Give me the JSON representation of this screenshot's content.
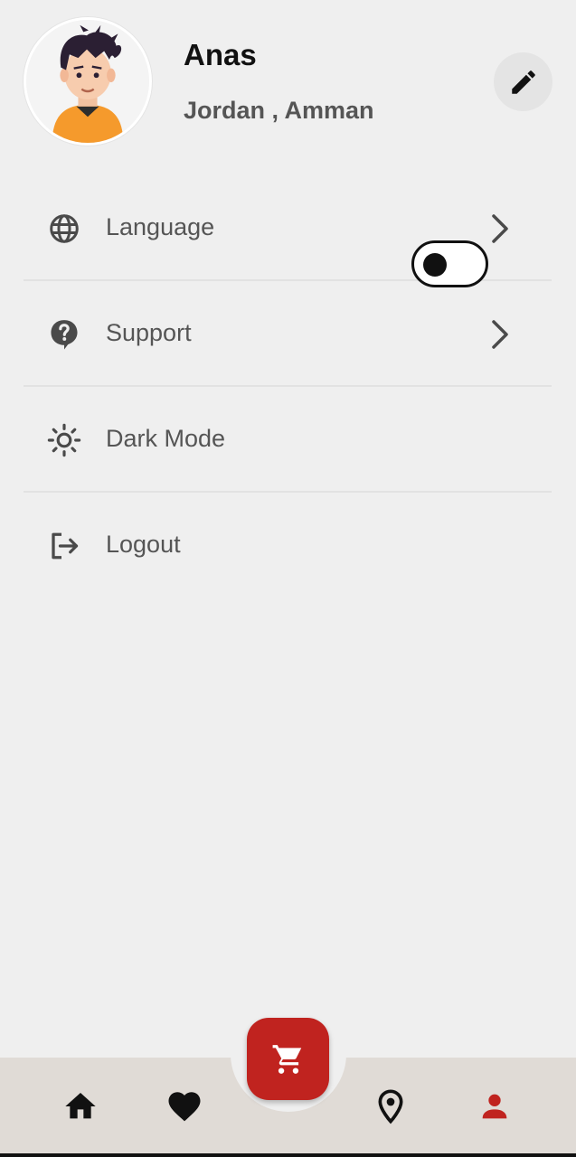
{
  "profile": {
    "name": "Anas",
    "location": "Jordan , Amman"
  },
  "menu": {
    "items": [
      {
        "label": "Language",
        "icon": "globe-icon"
      },
      {
        "label": "Support",
        "icon": "help-circle-icon"
      },
      {
        "label": "Dark Mode",
        "icon": "sun-icon",
        "toggle_on": false
      },
      {
        "label": "Logout",
        "icon": "logout-icon"
      }
    ]
  },
  "bottom_nav": {
    "items": [
      "home-icon",
      "heart-icon",
      "cart-icon",
      "location-pin-icon",
      "person-icon"
    ],
    "active": "person-icon"
  },
  "colors": {
    "accent": "#c0231f",
    "background": "#efefef",
    "nav_background": "#e0dbd6"
  }
}
